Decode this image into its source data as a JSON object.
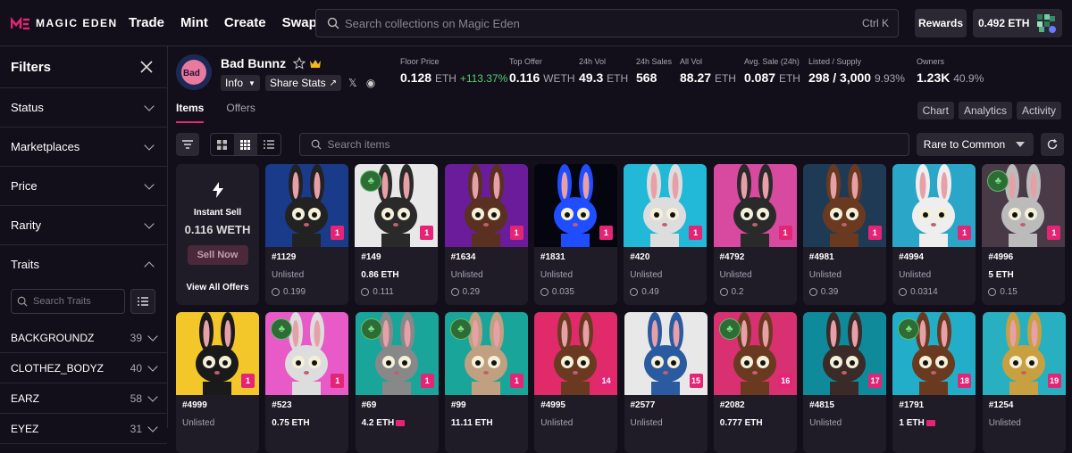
{
  "header": {
    "logo_text": "MAGIC EDEN",
    "nav": [
      "Trade",
      "Mint",
      "Create",
      "Swap"
    ],
    "search_placeholder": "Search collections on Magic Eden",
    "search_shortcut": "Ctrl K",
    "rewards_label": "Rewards",
    "wallet_balance": "0.492 ETH"
  },
  "sidebar": {
    "title": "Filters",
    "sections": [
      "Status",
      "Marketplaces",
      "Price",
      "Rarity",
      "Traits"
    ],
    "trait_search_placeholder": "Search Traits",
    "traits": [
      {
        "name": "BACKGROUNDZ",
        "count": "39"
      },
      {
        "name": "CLOTHEZ_BODYZ",
        "count": "40"
      },
      {
        "name": "EARZ",
        "count": "58"
      },
      {
        "name": "EYEZ",
        "count": "31"
      }
    ]
  },
  "collection": {
    "name": "Bad Bunnz",
    "info_label": "Info",
    "share_label": "Share Stats",
    "stats": {
      "floor": {
        "label": "Floor Price",
        "value": "0.128",
        "unit": "ETH",
        "change": "+113.37%"
      },
      "top_offer": {
        "label": "Top Offer",
        "value": "0.116",
        "unit": "WETH"
      },
      "vol24": {
        "label": "24h Vol",
        "value": "49.3",
        "unit": "ETH"
      },
      "sales24": {
        "label": "24h Sales",
        "value": "568"
      },
      "allvol": {
        "label": "All Vol",
        "value": "88.27",
        "unit": "ETH"
      },
      "avgsale": {
        "label": "Avg. Sale (24h)",
        "value": "0.087",
        "unit": "ETH"
      },
      "listed": {
        "label": "Listed / Supply",
        "value": "298 / 3,000",
        "pct": "9.93%"
      },
      "owners": {
        "label": "Owners",
        "value": "1.23K",
        "pct": "40.9%"
      }
    }
  },
  "tabs": [
    "Items",
    "Offers"
  ],
  "right_tabs": [
    "Chart",
    "Analytics",
    "Activity"
  ],
  "toolbar": {
    "search_placeholder": "Search items",
    "sort_label": "Rare to Common"
  },
  "instant_sell": {
    "title": "Instant Sell",
    "price": "0.116 WETH",
    "button": "Sell Now",
    "view_offers": "View All Offers"
  },
  "colors": {
    "accent": "#e42575",
    "positive": "#54d16c",
    "background": "#120f1a",
    "card": "#1f1b27"
  },
  "items_row1": [
    {
      "name": "#1129",
      "price": "Unlisted",
      "offer": "0.199",
      "rank": "1",
      "bg": "#1a3a8a",
      "fur": "#222222",
      "clover": false
    },
    {
      "name": "#149",
      "price": "0.86 ETH",
      "offer": "0.111",
      "rank": "1",
      "bg": "#e8e8e8",
      "fur": "#2a2a2a",
      "clover": true
    },
    {
      "name": "#1634",
      "price": "Unlisted",
      "offer": "0.29",
      "rank": "1",
      "bg": "#6a1c9a",
      "fur": "#5a3020",
      "clover": false
    },
    {
      "name": "#1831",
      "price": "Unlisted",
      "offer": "0.035",
      "rank": "1",
      "bg": "#05050f",
      "fur": "#1f4dff",
      "clover": false
    },
    {
      "name": "#420",
      "price": "Unlisted",
      "offer": "0.49",
      "rank": "1",
      "bg": "#22b8d8",
      "fur": "#dddddd",
      "clover": false
    },
    {
      "name": "#4792",
      "price": "Unlisted",
      "offer": "0.2",
      "rank": "1",
      "bg": "#d84aa0",
      "fur": "#2a2a2a",
      "clover": false
    },
    {
      "name": "#4981",
      "price": "Unlisted",
      "offer": "0.39",
      "rank": "1",
      "bg": "#1f3a55",
      "fur": "#6a3a20",
      "clover": false
    },
    {
      "name": "#4994",
      "price": "Unlisted",
      "offer": "0.0314",
      "rank": "1",
      "bg": "#2aa7c8",
      "fur": "#eeeeee",
      "clover": false
    },
    {
      "name": "#4996",
      "price": "5 ETH",
      "offer": "0.15",
      "rank": "1",
      "bg": "#4a3a48",
      "fur": "#bbbbbb",
      "clover": true
    }
  ],
  "items_row2": [
    {
      "name": "#4999",
      "price": "Unlisted",
      "rank": "1",
      "bg": "#f3c72a",
      "fur": "#1a1a1a",
      "clover": false
    },
    {
      "name": "#523",
      "price": "0.75 ETH",
      "rank": "1",
      "bg": "#e85ac8",
      "fur": "#dddddd",
      "clover": true
    },
    {
      "name": "#69",
      "price": "4.2 ETH",
      "rank": "1",
      "bg": "#1aa59a",
      "fur": "#888888",
      "clover": true,
      "me": true
    },
    {
      "name": "#99",
      "price": "11.11 ETH",
      "rank": "1",
      "bg": "#1aa59a",
      "fur": "#c0a080",
      "clover": true
    },
    {
      "name": "#4995",
      "price": "Unlisted",
      "rank": "14",
      "bg": "#e02a6a",
      "fur": "#6a3a20",
      "clover": false
    },
    {
      "name": "#2577",
      "price": "Unlisted",
      "rank": "15",
      "bg": "#e8e8e8",
      "fur": "#2a5aa0",
      "clover": false
    },
    {
      "name": "#2082",
      "price": "0.777 ETH",
      "rank": "16",
      "bg": "#d83070",
      "fur": "#6a3a20",
      "clover": true
    },
    {
      "name": "#4815",
      "price": "Unlisted",
      "rank": "17",
      "bg": "#0f8a9a",
      "fur": "#3a2a28",
      "clover": false
    },
    {
      "name": "#1791",
      "price": "1 ETH",
      "rank": "18",
      "bg": "#22aec8",
      "fur": "#6a3a20",
      "clover": true,
      "me": true
    },
    {
      "name": "#1254",
      "price": "Unlisted",
      "rank": "19",
      "bg": "#28b0c0",
      "fur": "#c8a040",
      "clover": false
    }
  ]
}
